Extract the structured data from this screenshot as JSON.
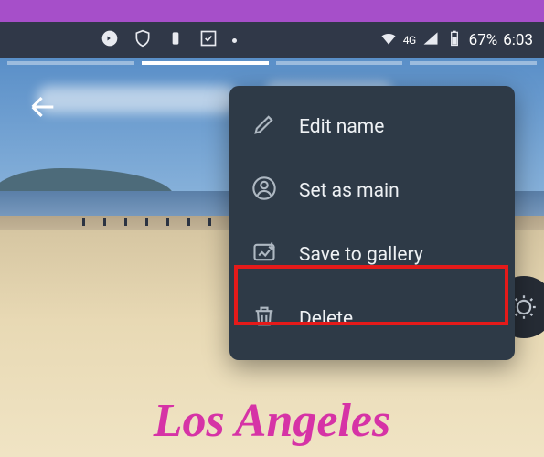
{
  "status": {
    "network_label": "4G",
    "battery_percent": "67%",
    "time": "6:03"
  },
  "menu": {
    "edit_name": "Edit name",
    "set_as_main": "Set as main",
    "save_to_gallery": "Save to gallery",
    "delete": "Delete"
  },
  "caption": "Los Angeles"
}
